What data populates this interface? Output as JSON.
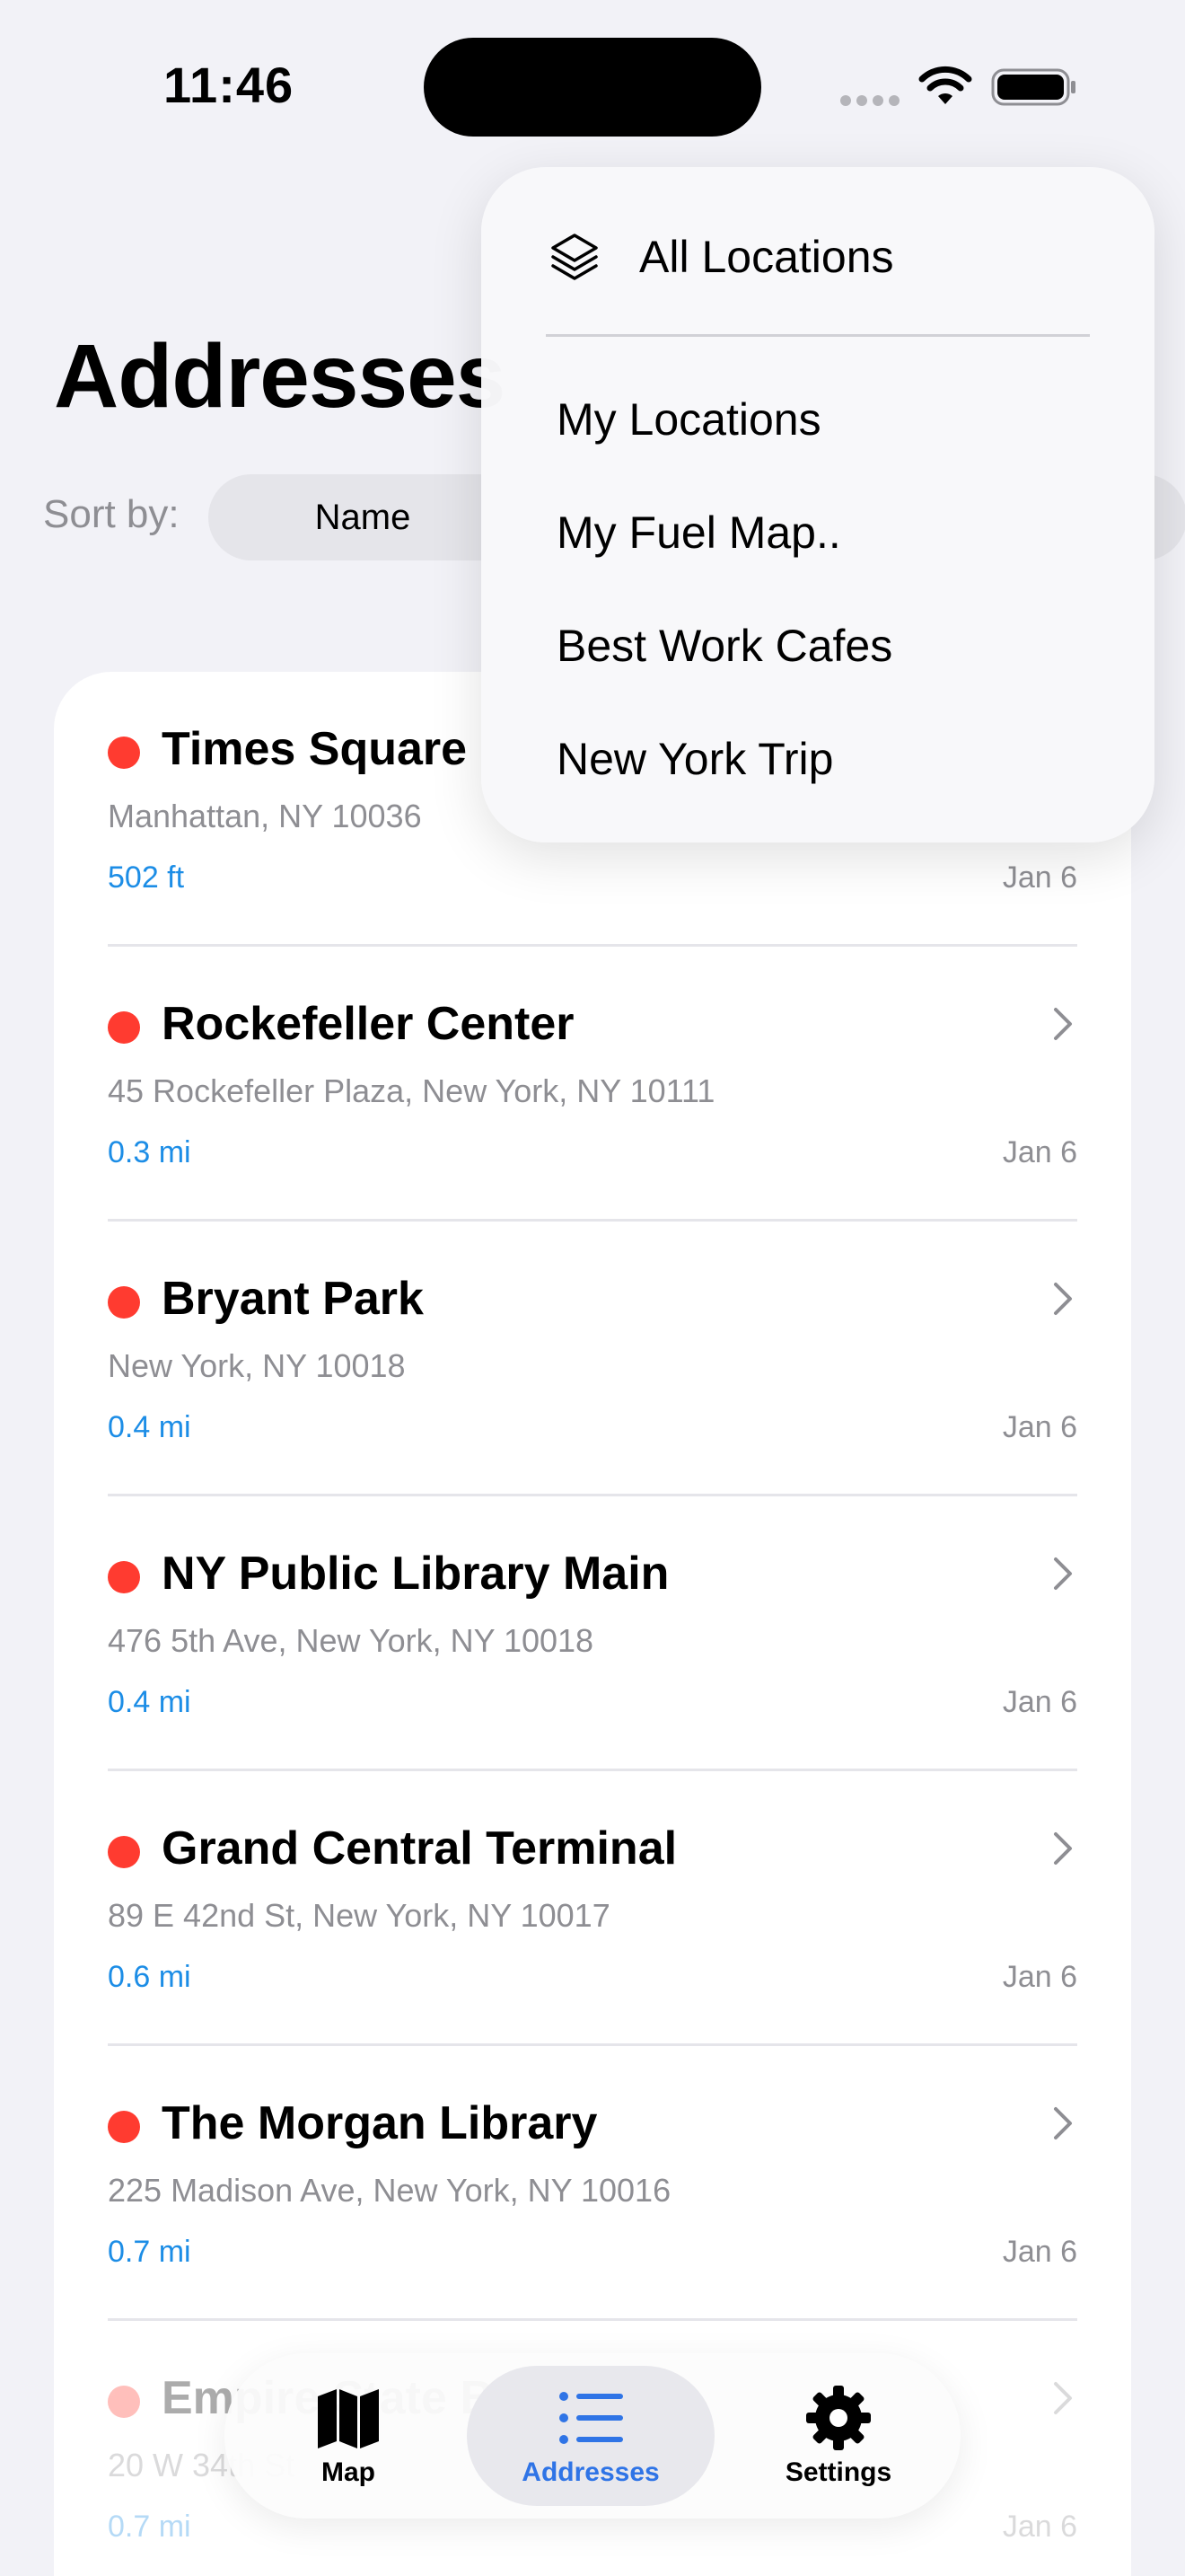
{
  "status": {
    "time": "11:46"
  },
  "header": {
    "title": "Addresses"
  },
  "sort": {
    "label": "Sort by:",
    "options": [
      "Name",
      "",
      ""
    ]
  },
  "locations": [
    {
      "name": "Times Square",
      "address": "Manhattan, NY 10036",
      "distance": "502 ft",
      "date": "Jan 6"
    },
    {
      "name": "Rockefeller Center",
      "address": "45 Rockefeller Plaza, New York, NY 10111",
      "distance": "0.3 mi",
      "date": "Jan 6"
    },
    {
      "name": "Bryant Park",
      "address": "New York, NY 10018",
      "distance": "0.4 mi",
      "date": "Jan 6"
    },
    {
      "name": "NY Public Library Main",
      "address": "476 5th Ave, New York, NY 10018",
      "distance": "0.4 mi",
      "date": "Jan 6"
    },
    {
      "name": "Grand Central Terminal",
      "address": "89 E 42nd St, New York, NY 10017",
      "distance": "0.6 mi",
      "date": "Jan 6"
    },
    {
      "name": "The Morgan Library",
      "address": "225 Madison Ave, New York, NY 10016",
      "distance": "0.7 mi",
      "date": "Jan 6"
    },
    {
      "name": "Empire State Building",
      "address": "20 W 34th St",
      "distance": "0.7 mi",
      "date": "Jan 6"
    }
  ],
  "menu": {
    "header_icon": "layers-icon",
    "header_label": "All Locations",
    "items": [
      "My Locations",
      "My Fuel Map..",
      "Best Work Cafes",
      "New York Trip"
    ]
  },
  "tabs": [
    {
      "label": "Map",
      "icon": "map-icon"
    },
    {
      "label": "Addresses",
      "icon": "list-icon"
    },
    {
      "label": "Settings",
      "icon": "gear-icon"
    }
  ],
  "colors": {
    "accent": "#2f74e6",
    "distance": "#1c8de6",
    "pin": "#ff3b30"
  }
}
